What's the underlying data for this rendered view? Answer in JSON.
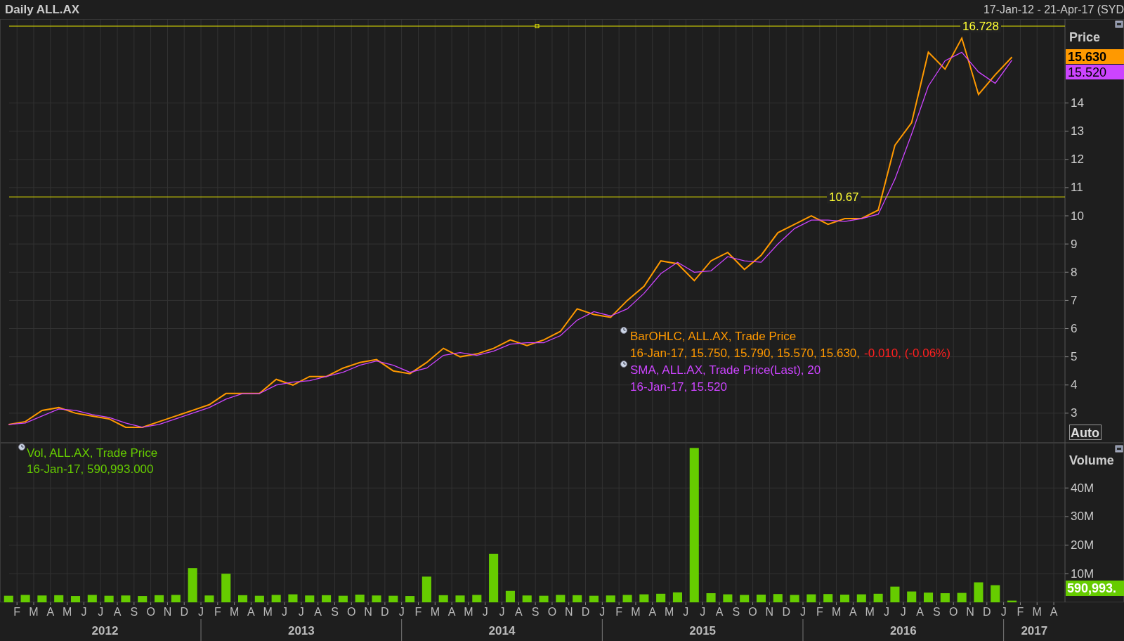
{
  "title": "Daily ALL.AX",
  "date_range": "17-Jan-12 - 21-Apr-17 (SYD",
  "price_pane": {
    "axis_title": "Price",
    "auto_button": "Auto",
    "tags": [
      {
        "text": "15.630",
        "color": "#ff9900"
      },
      {
        "text": "15.520",
        "color": "#cc44ff"
      }
    ],
    "legend": [
      {
        "kind": "ohlc",
        "values": "16-Jan-17, 15.750, 15.790, 15.570, 15.630,",
        "change": "-0.010, (-0.06%)"
      },
      {
        "kind": "sma",
        "values": "16-Jan-17, 15.520"
      }
    ],
    "chart_data": {
      "type": "line",
      "ylim": [
        1.95,
        16.98
      ],
      "yticks": [
        3,
        4,
        5,
        6,
        7,
        8,
        9,
        10,
        11,
        12,
        13,
        14
      ],
      "categories": [
        null,
        null,
        null,
        null,
        null,
        null,
        null,
        null,
        null,
        null,
        null,
        null,
        null,
        null,
        null,
        null,
        null,
        null,
        null,
        null,
        null,
        null,
        null,
        null,
        null,
        null,
        null,
        null,
        null,
        null,
        null,
        null,
        null,
        null,
        null,
        null,
        null,
        null,
        null,
        null,
        null,
        null,
        null,
        null,
        null,
        null,
        null,
        null,
        null,
        null,
        null,
        null,
        null,
        null,
        null,
        null,
        null,
        null,
        null,
        null,
        null
      ],
      "series": [
        {
          "name": "BarOHLC, ALL.AX, Trade Price",
          "color": "#ff9900",
          "values": [
            2.6,
            2.7,
            3.1,
            3.2,
            3.0,
            2.9,
            2.8,
            2.5,
            2.5,
            2.7,
            2.9,
            3.1,
            3.3,
            3.7,
            3.7,
            3.7,
            4.2,
            4.0,
            4.3,
            4.3,
            4.6,
            4.8,
            4.9,
            4.5,
            4.4,
            4.8,
            5.3,
            5.0,
            5.1,
            5.3,
            5.6,
            5.4,
            5.6,
            5.9,
            6.7,
            6.5,
            6.4,
            7.0,
            7.5,
            8.4,
            8.3,
            7.7,
            8.4,
            8.7,
            8.1,
            8.6,
            9.4,
            9.7,
            10.0,
            9.7,
            9.9,
            9.9,
            10.2,
            12.5,
            13.3,
            15.8,
            15.2,
            16.3,
            14.3,
            15.0,
            15.63
          ]
        },
        {
          "name": "SMA, ALL.AX, Trade Price(Last),  20",
          "color": "#cc44ff",
          "values": [
            2.6,
            2.65,
            2.9,
            3.15,
            3.1,
            2.95,
            2.85,
            2.65,
            2.5,
            2.6,
            2.8,
            3.0,
            3.2,
            3.5,
            3.7,
            3.7,
            4.0,
            4.1,
            4.15,
            4.3,
            4.45,
            4.7,
            4.85,
            4.7,
            4.45,
            4.6,
            5.05,
            5.15,
            5.05,
            5.2,
            5.45,
            5.5,
            5.5,
            5.75,
            6.3,
            6.6,
            6.45,
            6.7,
            7.25,
            7.95,
            8.35,
            8.0,
            8.05,
            8.55,
            8.4,
            8.35,
            9.0,
            9.55,
            9.85,
            9.85,
            9.8,
            9.9,
            10.05,
            11.3,
            12.9,
            14.6,
            15.5,
            15.8,
            15.1,
            14.7,
            15.52
          ]
        }
      ],
      "grid": true,
      "ref_lines": [
        {
          "axis": "y",
          "value": 16.728,
          "label": "16.728"
        },
        {
          "axis": "y",
          "value": 10.67,
          "label": "10.67"
        }
      ]
    }
  },
  "volume_pane": {
    "axis_title": "Volume",
    "tag": "590,993.",
    "legend": {
      "values": "16-Jan-17, 590,993.000"
    },
    "chart_data": {
      "type": "bar",
      "ylim": [
        0,
        55.8
      ],
      "grid": true,
      "yticks": [
        {
          "value": 10,
          "label": "10M"
        },
        {
          "value": 20,
          "label": "20M"
        },
        {
          "value": 30,
          "label": "30M"
        },
        {
          "value": 40,
          "label": "40M"
        }
      ],
      "categories": [
        null,
        null,
        null,
        null,
        null,
        null,
        null,
        null,
        null,
        null,
        null,
        null,
        null,
        null,
        null,
        null,
        null,
        null,
        null,
        null,
        null,
        null,
        null,
        null,
        null,
        null,
        null,
        null,
        null,
        null,
        null,
        null,
        null,
        null,
        null,
        null,
        null,
        null,
        null,
        null,
        null,
        null,
        null,
        null,
        null,
        null,
        null,
        null,
        null,
        null,
        null,
        null,
        null,
        null,
        null,
        null,
        null,
        null,
        null,
        null,
        null
      ],
      "series": [
        {
          "name": "Vol, ALL.AX, Trade Price",
          "color": "#66cc00",
          "values": [
            2.3,
            2.6,
            2.4,
            2.5,
            2.2,
            2.6,
            2.3,
            2.4,
            2.2,
            2.5,
            2.6,
            12.0,
            2.4,
            10.0,
            2.5,
            2.3,
            2.6,
            2.8,
            2.4,
            2.5,
            2.3,
            2.7,
            2.4,
            2.3,
            2.2,
            9.0,
            2.5,
            2.4,
            2.6,
            17.0,
            4.0,
            2.4,
            2.3,
            2.6,
            2.5,
            2.3,
            2.4,
            2.6,
            2.8,
            3.0,
            3.5,
            54.0,
            3.2,
            2.8,
            2.6,
            2.7,
            2.9,
            2.6,
            2.8,
            2.9,
            2.7,
            2.8,
            3.0,
            5.5,
            3.8,
            3.4,
            3.2,
            3.3,
            7.0,
            6.0,
            0.6
          ]
        }
      ]
    }
  },
  "x_axis": {
    "months": [
      "F",
      "M",
      "A",
      "M",
      "J",
      "J",
      "A",
      "S",
      "O",
      "N",
      "D",
      "J",
      "F",
      "M",
      "A",
      "M",
      "J",
      "J",
      "A",
      "S",
      "O",
      "N",
      "D",
      "J",
      "F",
      "M",
      "A",
      "M",
      "J",
      "J",
      "A",
      "S",
      "O",
      "N",
      "D",
      "J",
      "F",
      "M",
      "A",
      "M",
      "J",
      "J",
      "A",
      "S",
      "O",
      "N",
      "D",
      "J",
      "F",
      "M",
      "A",
      "M",
      "J",
      "J",
      "A",
      "S",
      "O",
      "N",
      "D",
      "J",
      "F",
      "M",
      "A"
    ],
    "years": [
      "2012",
      "2013",
      "2014",
      "2015",
      "2016",
      "2017"
    ]
  }
}
